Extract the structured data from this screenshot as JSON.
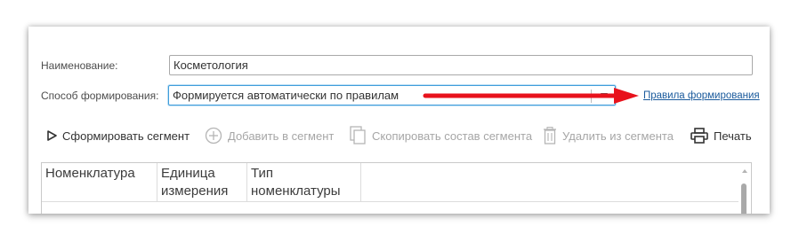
{
  "form": {
    "name_label": "Наименование:",
    "name_value": "Косметология",
    "method_label": "Способ формирования:",
    "method_value": "Формируется автоматически по правилам",
    "rules_link": "Правила формирования"
  },
  "toolbar": {
    "generate": "Сформировать сегмент",
    "add": "Добавить в сегмент",
    "copy": "Скопировать состав сегмента",
    "remove": "Удалить из сегмента",
    "print": "Печать"
  },
  "table": {
    "columns": [
      {
        "line1": "Номенклатура",
        "line2": ""
      },
      {
        "line1": "Единица",
        "line2": "измерения"
      },
      {
        "line1": "Тип",
        "line2": "номенклатуры"
      }
    ]
  },
  "colors": {
    "arrow": "#e8121c",
    "link": "#1a5a9c",
    "focus": "#3f9ddb"
  },
  "icons": [
    "play-icon",
    "add-circle-icon",
    "copy-icon",
    "trash-icon",
    "printer-icon",
    "chevron-down-icon",
    "scroll-up-icon"
  ]
}
